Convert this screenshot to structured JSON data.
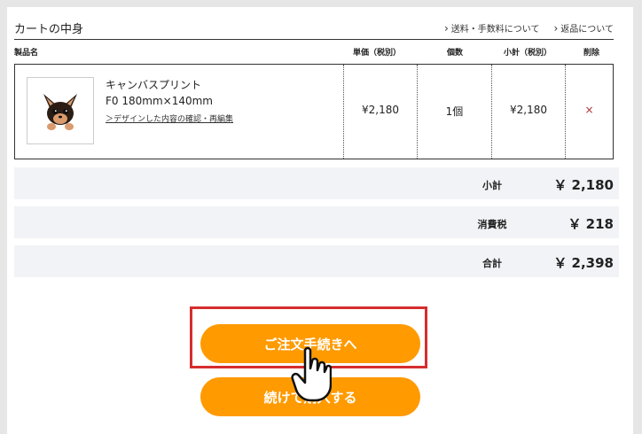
{
  "cart": {
    "title": "カートの中身",
    "links": [
      "送料・手数料について",
      "返品について"
    ]
  },
  "columns": {
    "product": "製品名",
    "unit_price": "単価（税別）",
    "qty": "個数",
    "subtotal": "小計（税別）",
    "delete": "削除"
  },
  "item": {
    "name": "キャンバスプリント",
    "size": "F0 180mm×140mm",
    "link": "＞デザインした内容の確認・再編集",
    "unit_price": "¥2,180",
    "qty": "1個",
    "subtotal": "¥2,180",
    "delete": "×",
    "thumb_icon": "dog-illustration"
  },
  "summary": [
    {
      "label": "小計",
      "value": "￥ 2,180"
    },
    {
      "label": "消費税",
      "value": "￥ 218"
    },
    {
      "label": "合計",
      "value": "￥ 2,398"
    }
  ],
  "buttons": {
    "checkout": "ご注文手続きへ",
    "continue": "続けて購入する"
  },
  "colors": {
    "accent": "#ff9a00",
    "highlight": "#d62d2d",
    "row_bg": "#f1f3f6"
  },
  "cursor_icon": "pointing-hand-cursor"
}
